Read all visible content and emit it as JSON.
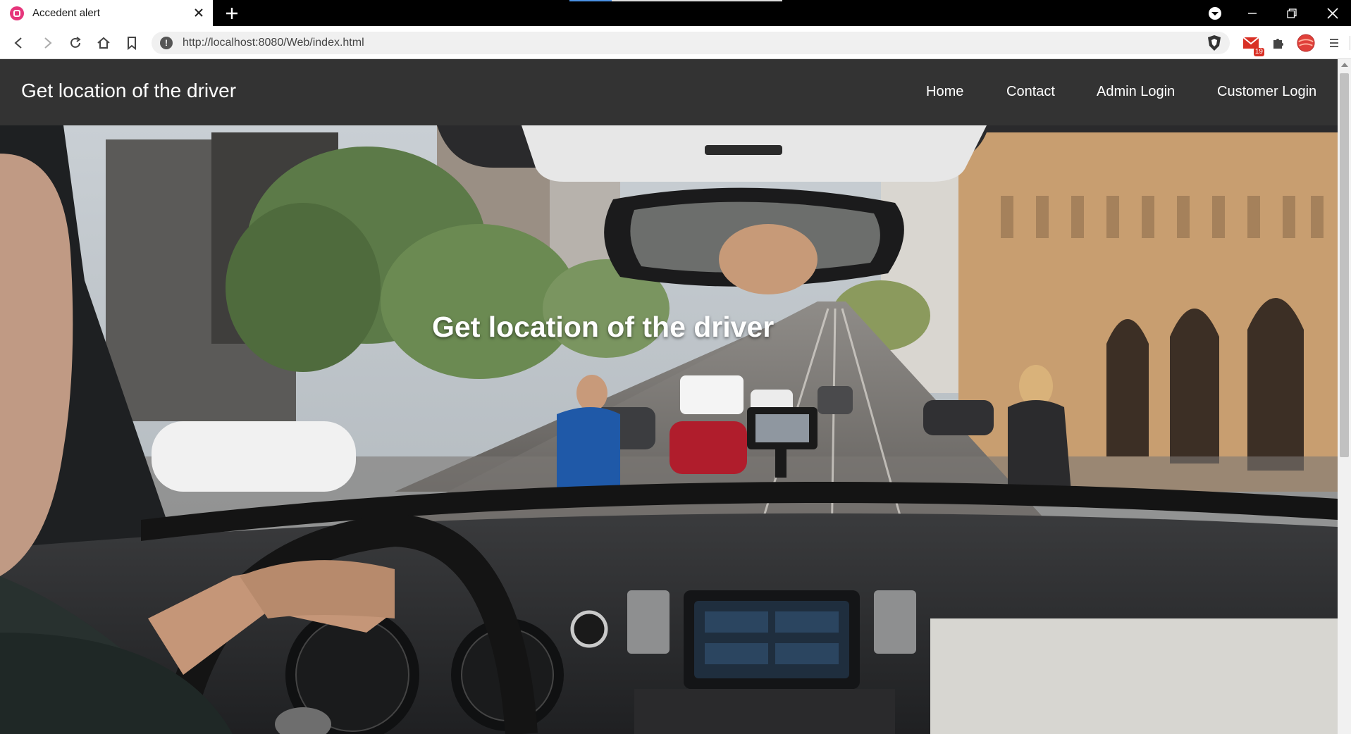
{
  "browser": {
    "tab_title": "Accedent alert",
    "url": "http://localhost:8080/Web/index.html",
    "extension_badge": "19"
  },
  "site": {
    "brand": "Get location of the driver",
    "nav": [
      "Home",
      "Contact",
      "Admin Login",
      "Customer Login"
    ],
    "hero_title": "Get location of the driver"
  },
  "colors": {
    "navbar_bg": "#333333",
    "favicon": "#e6357b"
  },
  "icons": [
    "back-icon",
    "forward-icon",
    "reload-icon",
    "home-icon",
    "bookmark-icon",
    "site-info-icon",
    "brave-shield-icon",
    "mail-extension-icon",
    "extensions-icon",
    "profile-icon",
    "menu-icon"
  ]
}
